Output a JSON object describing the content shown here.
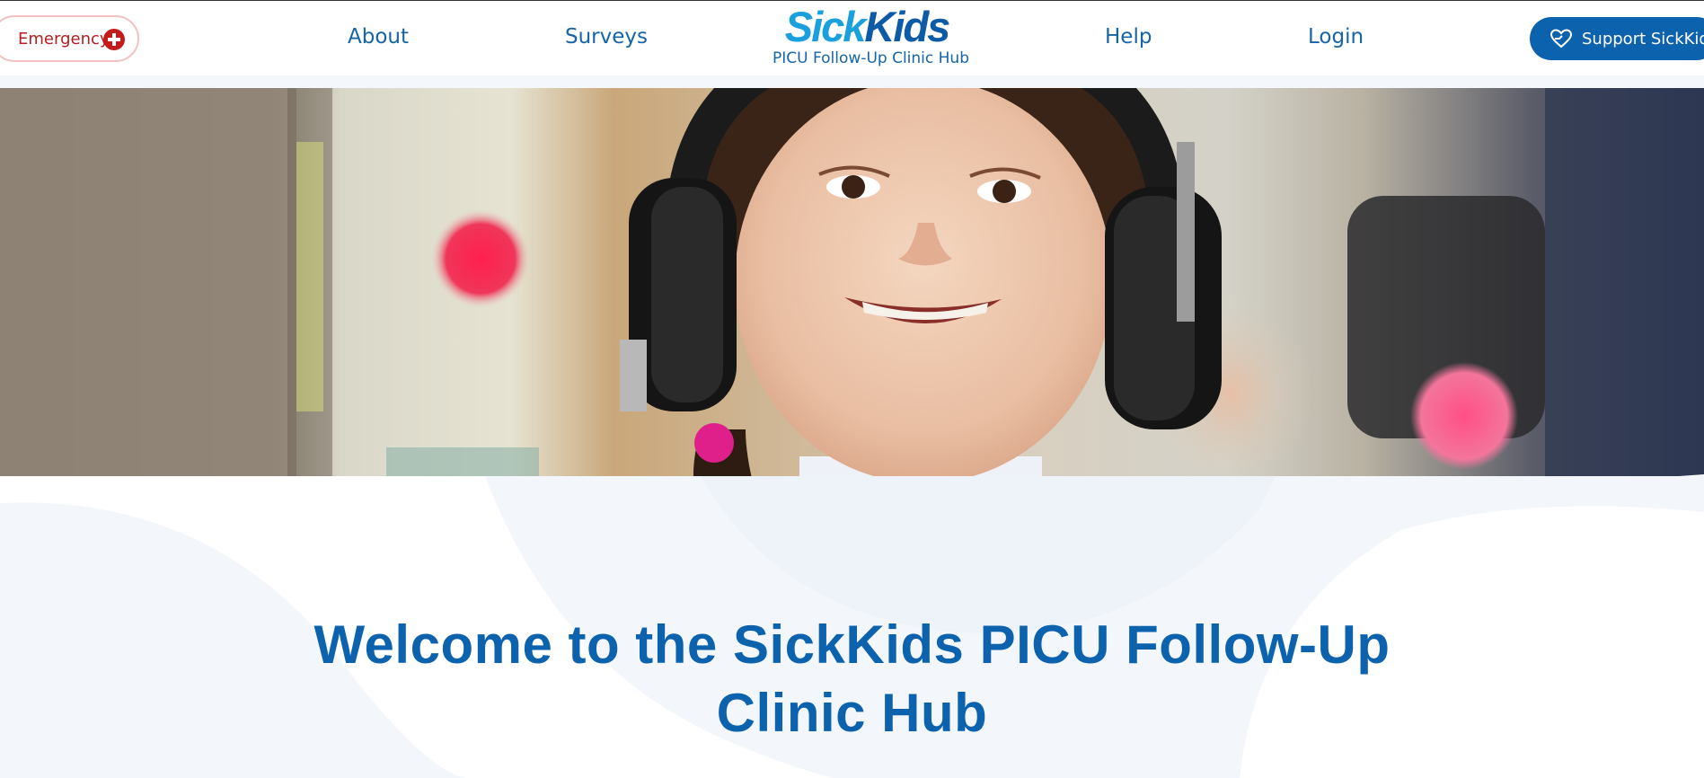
{
  "header": {
    "emergency_label": "Emergency",
    "nav": {
      "about": "About",
      "surveys": "Surveys",
      "help": "Help",
      "login": "Login"
    },
    "logo": {
      "sick": "Sick",
      "kids": "Kids",
      "reg": "®",
      "subtitle": "PICU Follow-Up Clinic Hub"
    },
    "support_label": "Support SickKids"
  },
  "hero": {
    "image_subject": "smiling child wearing headphones"
  },
  "main": {
    "welcome_title": "Welcome to the SickKids PICU Follow-Up Clinic Hub"
  },
  "colors": {
    "brand_blue": "#0d62ae",
    "logo_light_blue": "#1aa0dc",
    "emergency_red": "#b41f1f"
  }
}
